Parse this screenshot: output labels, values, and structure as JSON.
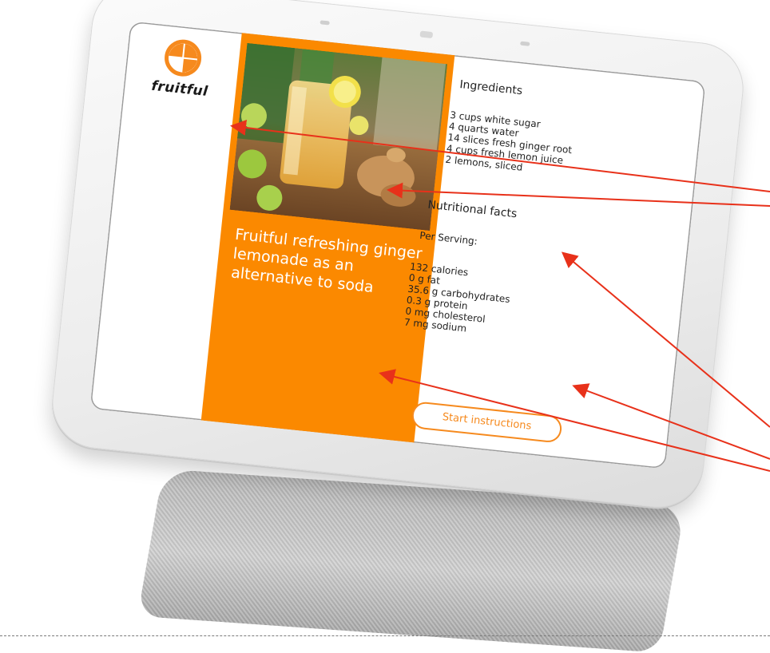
{
  "app": {
    "logo_text": "fruitful",
    "accent_color": "#fb8900"
  },
  "recipe": {
    "title": "Fruitful refreshing ginger lemonade as an alternative to soda",
    "image_icon": "ginger-lemonade-photo"
  },
  "ingredients": {
    "heading": "Ingredients",
    "items": [
      "3 cups white sugar",
      "4 quarts water",
      "14 slices fresh ginger root",
      "4 cups fresh lemon juice",
      "2 lemons, sliced"
    ]
  },
  "nutrition": {
    "heading": "Nutritional facts",
    "per_serving": "Per Serving:",
    "items": [
      "132 calories",
      "0 g fat",
      "35.6 g carbohydrates",
      "0.3 g protein",
      "0 mg cholesterol",
      "7 mg sodium"
    ]
  },
  "actions": {
    "start_label": "Start instructions"
  },
  "annotations": {
    "arrow_color": "#e8311a",
    "arrow_count": 5
  }
}
